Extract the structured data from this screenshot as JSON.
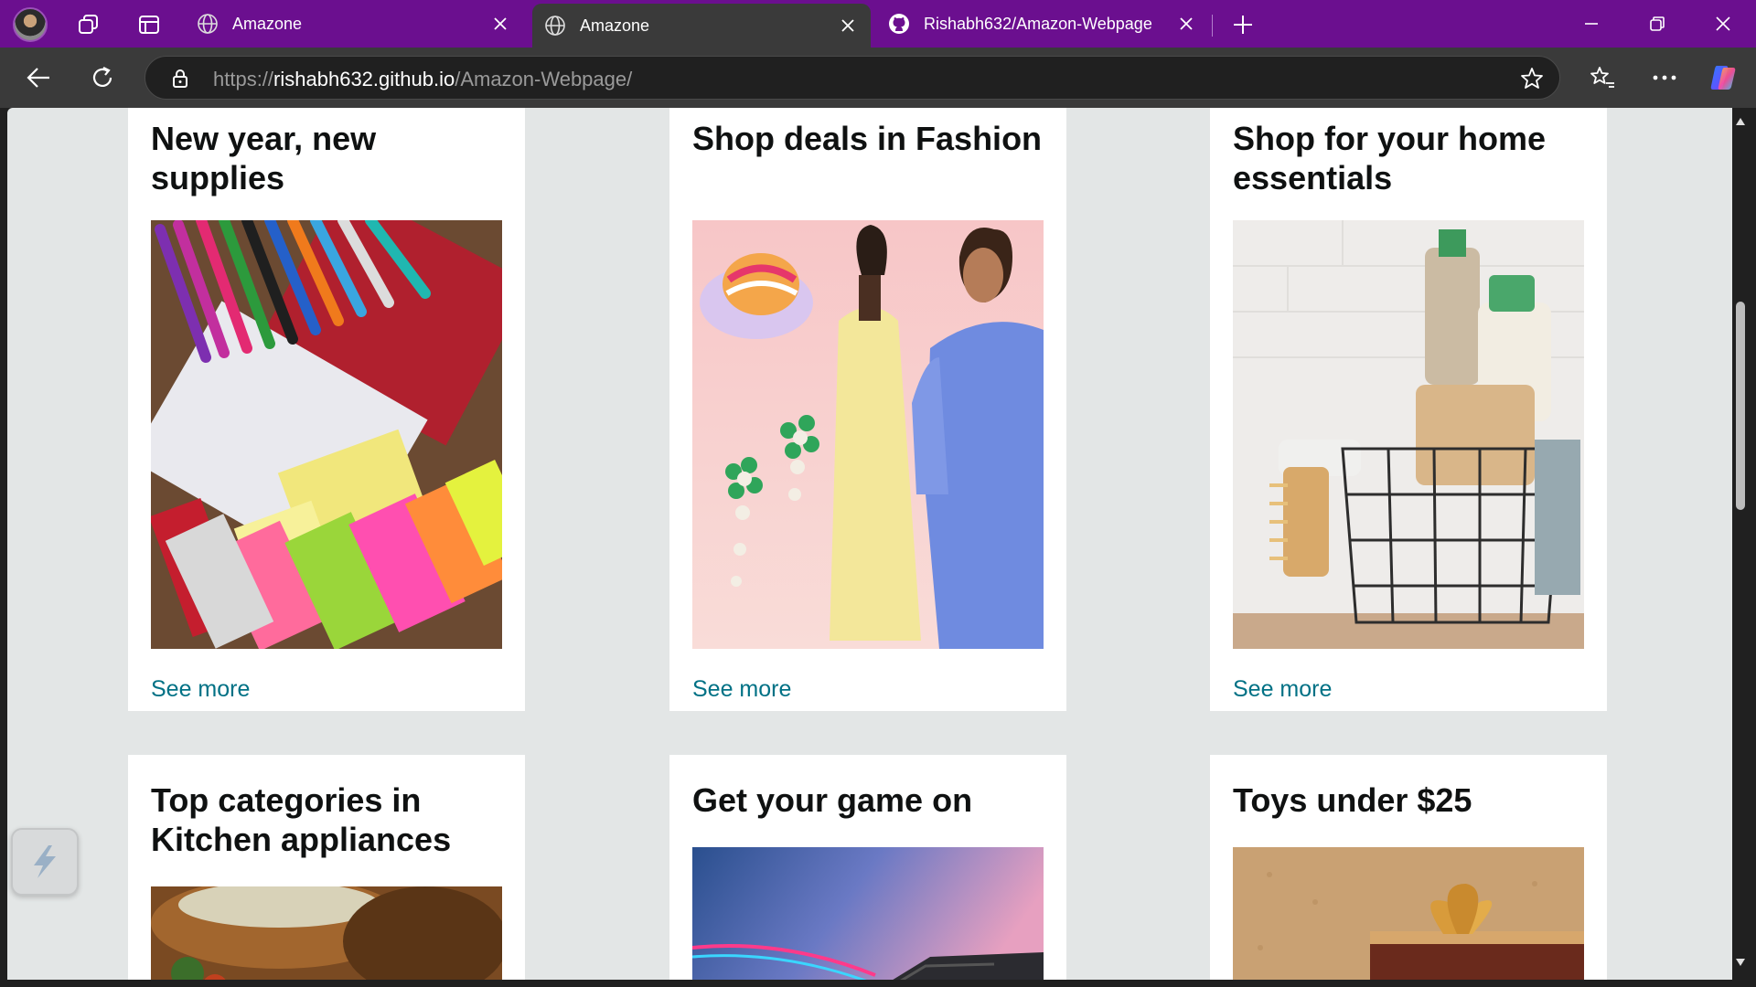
{
  "browser": {
    "tabs": [
      {
        "label": "Amazone",
        "icon": "globe-icon",
        "active": false
      },
      {
        "label": "Amazone",
        "icon": "globe-icon",
        "active": true
      },
      {
        "label": "Rishabh632/Amazon-Webpage",
        "icon": "github-icon",
        "active": false
      }
    ],
    "address": {
      "scheme": "https://",
      "host": "rishabh632.github.io",
      "path": "/Amazon-Webpage/"
    },
    "theme_color": "#6b0f8f"
  },
  "page": {
    "link_color": "#007185",
    "cards": [
      {
        "title": "New year, new supplies",
        "link": "See more"
      },
      {
        "title": "Shop deals in Fashion",
        "link": "See more"
      },
      {
        "title": "Shop for your home essentials",
        "link": "See more"
      },
      {
        "title": "Top categories in Kitchen appliances"
      },
      {
        "title": "Get your game on"
      },
      {
        "title": "Toys under $25"
      }
    ]
  }
}
